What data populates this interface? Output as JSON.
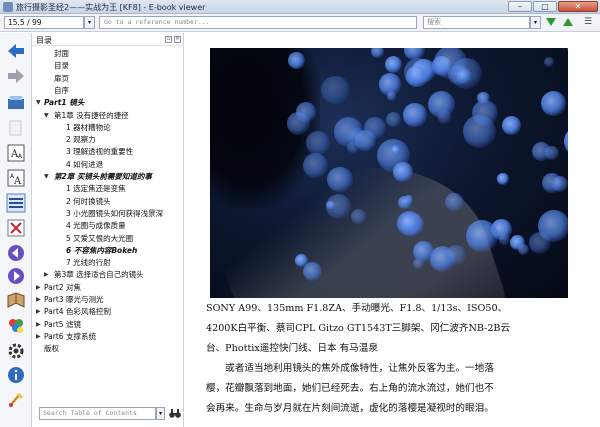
{
  "window": {
    "title": "旅行摄影圣经2——实战为王 [KF8] - E-book viewer",
    "buttons": {
      "minimize": "–",
      "maximize": "□",
      "close": "✕"
    }
  },
  "toolbar": {
    "page_position": "15.5 / 99",
    "reference_placeholder": "Go to a reference number...",
    "search_placeholder": "搜索",
    "next_match_icon": "triangle-down-icon",
    "prev_match_icon": "triangle-up-icon",
    "menu_icon": "hamburger-icon"
  },
  "sidebar_icons": [
    "back-arrow-icon",
    "forward-arrow-icon",
    "library-icon",
    "copy-icon",
    "font-larger-icon",
    "font-smaller-icon",
    "toc-icon",
    "fullscreen-icon",
    "previous-page-icon",
    "next-page-icon",
    "bookmark-icon",
    "theme-icon",
    "preferences-icon",
    "info-icon",
    "print-icon"
  ],
  "toc": {
    "title": "目录",
    "search_placeholder": "Search Table of Contents",
    "items": [
      {
        "label": "封面",
        "level": 1,
        "arrow": "",
        "bold": false
      },
      {
        "label": "目录",
        "level": 1,
        "arrow": "",
        "bold": false
      },
      {
        "label": "扉页",
        "level": 1,
        "arrow": "",
        "bold": false
      },
      {
        "label": "自序",
        "level": 1,
        "arrow": "",
        "bold": false
      },
      {
        "label": "Part1 镜头",
        "level": 0,
        "arrow": "▼",
        "bold": true
      },
      {
        "label": "第1章 没有捷径的捷径",
        "level": 1,
        "arrow": "▼",
        "bold": false
      },
      {
        "label": "1 器材糟物论",
        "level": 2,
        "arrow": "",
        "bold": false
      },
      {
        "label": "2 观察力",
        "level": 2,
        "arrow": "",
        "bold": false
      },
      {
        "label": "3 理解透视的重要性",
        "level": 2,
        "arrow": "",
        "bold": false
      },
      {
        "label": "4 如何进退",
        "level": 2,
        "arrow": "",
        "bold": false
      },
      {
        "label": "第2章 买镜头前需要知道的事",
        "level": 1,
        "arrow": "▼",
        "bold": true
      },
      {
        "label": "1 选定焦还是变焦",
        "level": 2,
        "arrow": "",
        "bold": false
      },
      {
        "label": "2 何时换镜头",
        "level": 2,
        "arrow": "",
        "bold": false
      },
      {
        "label": "3 小光圈镜头如何获得浅景深",
        "level": 2,
        "arrow": "",
        "bold": false
      },
      {
        "label": "4 光圈与成像质量",
        "level": 2,
        "arrow": "",
        "bold": false
      },
      {
        "label": "5 又爱又恨的大光圈",
        "level": 2,
        "arrow": "",
        "bold": false
      },
      {
        "label": "6 不容焦内容Bokeh",
        "level": 2,
        "arrow": "",
        "bold": true
      },
      {
        "label": "7 光线的行射",
        "level": 2,
        "arrow": "",
        "bold": false
      },
      {
        "label": "第3章 选择适合自己的镜头",
        "level": 1,
        "arrow": "▶",
        "bold": false
      },
      {
        "label": "Part2 对焦",
        "level": 0,
        "arrow": "▶",
        "bold": false
      },
      {
        "label": "Part3 曝光与测光",
        "level": 0,
        "arrow": "▶",
        "bold": false
      },
      {
        "label": "Part4 色彩风格控制",
        "level": 0,
        "arrow": "▶",
        "bold": false
      },
      {
        "label": "Part5 滤镜",
        "level": 0,
        "arrow": "▶",
        "bold": false
      },
      {
        "label": "Part6 支撑系统",
        "level": 0,
        "arrow": "▶",
        "bold": false
      },
      {
        "label": "版权",
        "level": 0,
        "arrow": "",
        "bold": false
      }
    ]
  },
  "content": {
    "caption_line1": "SONY A99、135mm F1.8ZA、手动曝光、F1.8、1/13s、ISO50、",
    "caption_line2": "4200K白平衡、蔡司CPL Gitzo GT1543T三脚架、冈仁波齐NB-2B云",
    "caption_line3": "台、Phottix遥控快门线、日本 有马温泉",
    "body_line1": "　　或者适当地利用镜头的焦外成像特性，让焦外反客为主。一地落",
    "body_line2": "樱，花瓣飘落到地面，她们已经死去。右上角的流水流过，她们也不",
    "body_line3": "会再来。生命与岁月就在片刻间流逝，虚化的落樱是凝视时的眼泪。"
  }
}
